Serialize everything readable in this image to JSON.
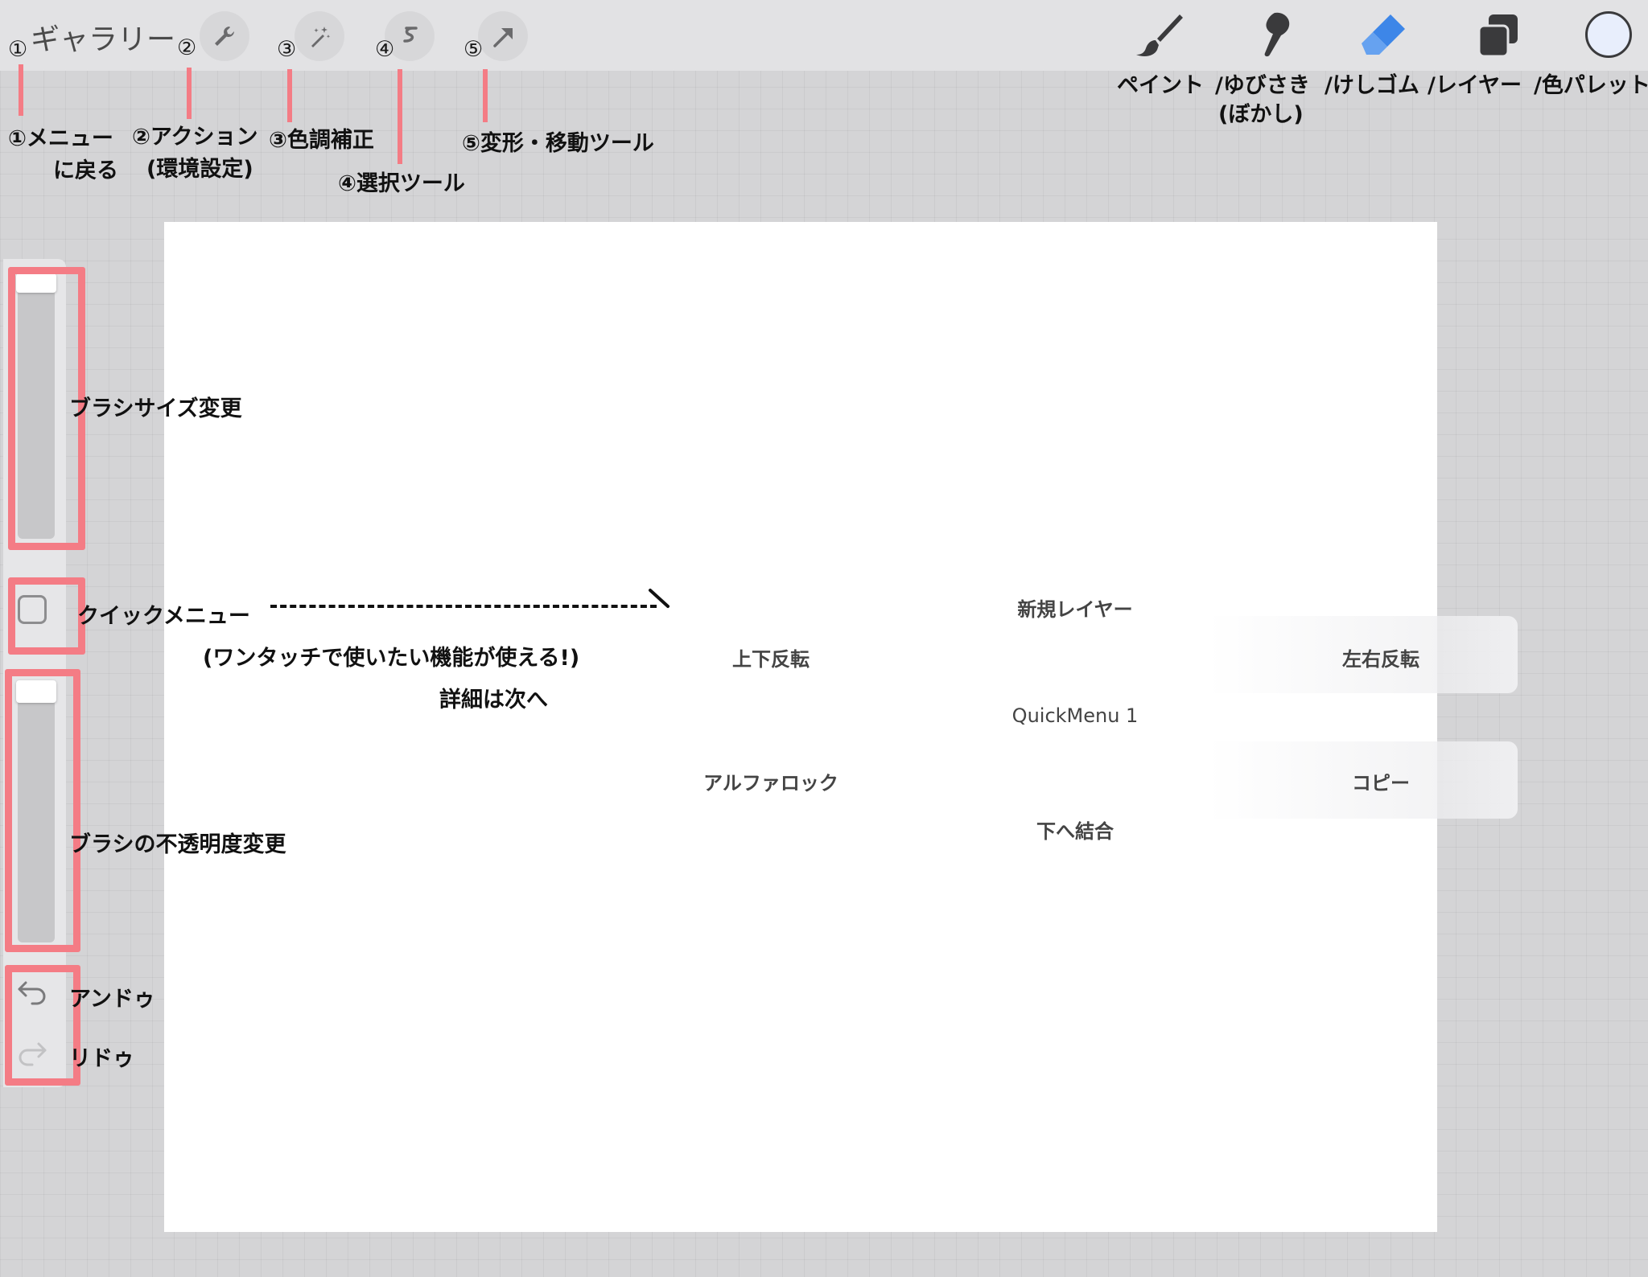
{
  "topbar": {
    "gallery_label": "ギャラリー",
    "tool_numbers": [
      "①",
      "②",
      "③",
      "④",
      "⑤"
    ],
    "left_icons": [
      "wrench-icon",
      "magic-wand-icon",
      "selection-icon",
      "arrow-icon"
    ],
    "right_icons": [
      "brush-icon",
      "smudge-icon",
      "eraser-icon",
      "layers-icon",
      "color-swatch"
    ],
    "right_labels": [
      "ペイント",
      "/ゆびさき",
      "(ぼかし)",
      "/けしゴム",
      "/レイヤー",
      "/色パレット"
    ]
  },
  "annotations": {
    "menu_line1": "①メニュー",
    "menu_line2": "に戻る",
    "action_line1": "②アクション",
    "action_line2": "(環境設定)",
    "adjust": "③色調補正",
    "select": "④選択ツール",
    "transform": "⑤変形・移動ツール",
    "brush_size": "ブラシサイズ変更",
    "quick_menu": "クイックメニュー",
    "quick_menu_desc": "(ワンタッチで使いたい機能が使える!)",
    "quick_menu_more": "詳細は次へ",
    "opacity": "ブラシの不透明度変更",
    "undo": "アンドゥ",
    "redo": "リドゥ"
  },
  "quickmenu": {
    "title": "QuickMenu 1",
    "new_layer": "新規レイヤー",
    "flip_vertical": "上下反転",
    "flip_horizontal": "左右反転",
    "alpha_lock": "アルファロック",
    "copy": "コピー",
    "merge_down": "下へ結合"
  },
  "colors": {
    "accent_pink": "#f47c85",
    "eraser_blue": "#3d86e8",
    "current_color": "#e8eefc"
  }
}
